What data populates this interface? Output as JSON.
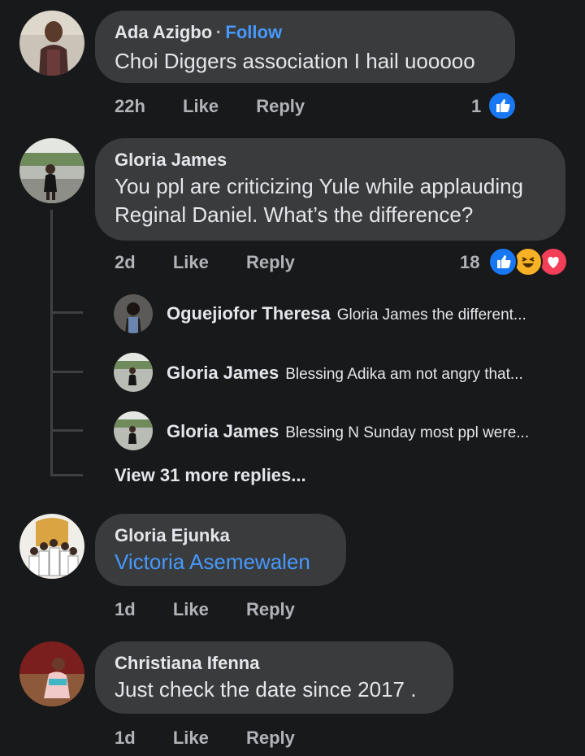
{
  "comments": [
    {
      "name": "Ada Azigbo",
      "separator": "·",
      "follow": "Follow",
      "text": "Choi Diggers association I hail uooooo",
      "time": "22h",
      "like": "Like",
      "reply": "Reply",
      "reaction_count": "1",
      "reactions": [
        "like-icon"
      ]
    },
    {
      "name": "Gloria James",
      "text_line1": "You ppl are criticizing Yule while applauding",
      "text_line2": "Reginal Daniel. What’s the difference?",
      "time": "2d",
      "like": "Like",
      "reply": "Reply",
      "reaction_count": "18",
      "reactions": [
        "like-icon",
        "haha-icon",
        "love-icon"
      ]
    },
    {
      "name": "Gloria Ejunka",
      "text": "Victoria Asemewalen",
      "time": "1d",
      "like": "Like",
      "reply": "Reply"
    },
    {
      "name": "Christiana Ifenna",
      "text": "Just check the date since 2017 .",
      "time": "1d",
      "like": "Like",
      "reply": "Reply"
    }
  ],
  "replies": [
    {
      "name": "Oguejiofor Theresa",
      "text": "Gloria James  the different..."
    },
    {
      "name": "Gloria James",
      "text": "Blessing Adika am not angry that..."
    },
    {
      "name": "Gloria James",
      "text": "Blessing N Sunday most ppl were..."
    }
  ],
  "view_more": "View 31 more replies...",
  "colors": {
    "background": "#18191a",
    "bubble": "#3a3b3c",
    "link": "#4599ff",
    "like": "#1877f2",
    "love": "#f33e58",
    "haha": "#f7b125"
  }
}
